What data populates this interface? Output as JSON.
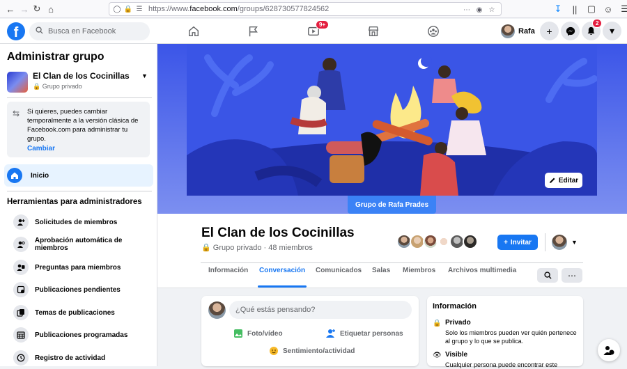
{
  "browser": {
    "url_prefix": "https://www.",
    "url_domain": "facebook.com",
    "url_path": "/groups/628730577824562"
  },
  "fb": {
    "search_placeholder": "Busca en Facebook",
    "watch_badge": "9+",
    "notif_badge": "2",
    "user_name": "Rafa"
  },
  "sidebar": {
    "title": "Administrar grupo",
    "group_name": "El Clan de los Cocinillas",
    "group_privacy": "Grupo privado",
    "notice_text": "Si quieres, puedes cambiar temporalmente a la versión clásica de Facebook.com para administrar tu grupo.",
    "notice_link": "Cambiar",
    "home_label": "Inicio",
    "tools_title": "Herramientas para administradores",
    "tools": [
      {
        "label": "Solicitudes de miembros",
        "icon": "member-requests-icon"
      },
      {
        "label": "Aprobación automática de miembros",
        "icon": "auto-approve-icon"
      },
      {
        "label": "Preguntas para miembros",
        "icon": "questions-icon"
      },
      {
        "label": "Publicaciones pendientes",
        "icon": "pending-posts-icon"
      },
      {
        "label": "Temas de publicaciones",
        "icon": "topics-icon"
      },
      {
        "label": "Publicaciones programadas",
        "icon": "scheduled-icon"
      },
      {
        "label": "Registro de actividad",
        "icon": "activity-log-icon"
      }
    ]
  },
  "cover": {
    "edit_label": "Editar",
    "group_pill": "Grupo de Rafa Prades"
  },
  "header": {
    "title": "El Clan de los Cocinillas",
    "privacy": "Grupo privado",
    "separator": " · ",
    "members": "48 miembros",
    "invite_label": "Invitar",
    "tabs": [
      "Información",
      "Conversación",
      "Comunicados",
      "Salas",
      "Miembros",
      "Archivos multimedia"
    ],
    "active_tab": "Conversación"
  },
  "composer": {
    "placeholder": "¿Qué estás pensando?",
    "photo": "Foto/vídeo",
    "tag": "Etiquetar personas",
    "feeling": "Sentimiento/actividad"
  },
  "info": {
    "title": "Información",
    "private_title": "Privado",
    "private_desc": "Solo los miembros pueden ver quién pertenece al grupo y lo que se publica.",
    "visible_title": "Visible",
    "visible_desc": "Cualquier persona puede encontrar este"
  },
  "colors": {
    "brand": "#1877f2",
    "notification": "#e41e3f",
    "cover_blue": "#3a55e6"
  }
}
